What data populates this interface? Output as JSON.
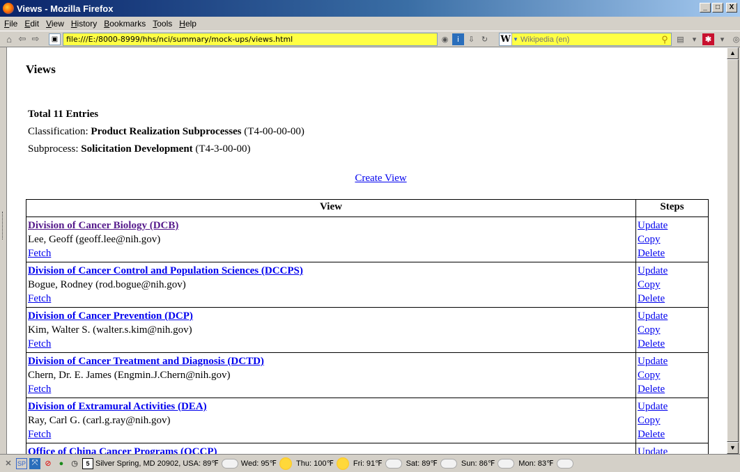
{
  "window": {
    "title": "Views - Mozilla Firefox",
    "controls": {
      "minimize": "_",
      "maximize": "□",
      "close": "X"
    }
  },
  "menu": [
    "File",
    "Edit",
    "View",
    "History",
    "Bookmarks",
    "Tools",
    "Help"
  ],
  "nav": {
    "url": "file:///E:/8000-8999/hhs/nci/summary/mock-ups/views.html",
    "search_placeholder": "Wikipedia (en)",
    "search_engine_letter": "W"
  },
  "page": {
    "heading": "Views",
    "total": "Total 11 Entries",
    "classification_label": "Classification: ",
    "classification_name": "Product Realization Subprocesses",
    "classification_code": " (T4-00-00-00)",
    "subprocess_label": "Subprocess: ",
    "subprocess_name": "Solicitation Development",
    "subprocess_code": " (T4-3-00-00)",
    "create_link": "Create View"
  },
  "table": {
    "headers": {
      "view": "View",
      "steps": "Steps"
    },
    "rows": [
      {
        "title": "Division of Cancer Biology (DCB)",
        "contact": "Lee, Geoff (geoff.lee@nih.gov)",
        "fetch": "Fetch",
        "update": "Update",
        "copy": "Copy",
        "delete": "Delete"
      },
      {
        "title": "Division of Cancer Control and Population Sciences (DCCPS)",
        "contact": "Bogue, Rodney (rod.bogue@nih.gov)",
        "fetch": "Fetch",
        "update": "Update",
        "copy": "Copy",
        "delete": "Delete"
      },
      {
        "title": "Division of Cancer Prevention (DCP)",
        "contact": "Kim, Walter S. (walter.s.kim@nih.gov)",
        "fetch": "Fetch",
        "update": "Update",
        "copy": "Copy",
        "delete": "Delete"
      },
      {
        "title": "Division of Cancer Treatment and Diagnosis (DCTD)",
        "contact": "Chern, Dr. E. James (Engmin.J.Chern@nih.gov)",
        "fetch": "Fetch",
        "update": "Update",
        "copy": "Copy",
        "delete": "Delete"
      },
      {
        "title": "Division of Extramural Activities (DEA)",
        "contact": "Ray, Carl G. (carl.g.ray@nih.gov)",
        "fetch": "Fetch",
        "update": "Update",
        "copy": "Copy",
        "delete": "Delete"
      },
      {
        "title": "Office of China Cancer Programs (OCCP)",
        "contact": "",
        "fetch": "",
        "update": "Update",
        "copy": "",
        "delete": ""
      }
    ]
  },
  "status": {
    "calendar_day": "5",
    "location": "Silver Spring, MD 20902, USA: 89℉",
    "forecast": [
      {
        "label": "Wed: 95℉",
        "icon": "sun-icon"
      },
      {
        "label": "Thu: 100℉",
        "icon": "sun-icon"
      },
      {
        "label": "Fri: 91℉",
        "icon": "partly-cloudy-icon"
      },
      {
        "label": "Sat: 89℉",
        "icon": "partly-cloudy-icon"
      },
      {
        "label": "Sun: 86℉",
        "icon": "partly-cloudy-icon"
      },
      {
        "label": "Mon: 83℉",
        "icon": "partly-cloudy-icon"
      }
    ]
  }
}
